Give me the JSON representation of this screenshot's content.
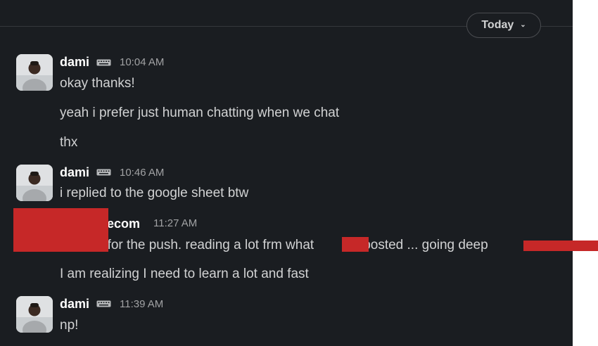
{
  "divider": {
    "label": "Today",
    "chevron_icon": "chevron-down-icon"
  },
  "messages": [
    {
      "author": "dami",
      "time": "10:04 AM",
      "lines": [
        "okay thanks!",
        "yeah i prefer just human chatting when we chat",
        "thx"
      ]
    },
    {
      "author": "dami",
      "time": "10:46 AM",
      "lines": [
        "i replied to the google sheet btw"
      ]
    },
    {
      "author": "ecom",
      "time": "11:27 AM",
      "lines": [
        "Thanks for the push. reading a lot frm what",
        "posted ... going deep",
        "I am realizing I need to learn a lot and fast"
      ]
    },
    {
      "author": "dami",
      "time": "11:39 AM",
      "lines": [
        "np!"
      ]
    }
  ],
  "colors": {
    "background": "#1a1d21",
    "text": "#d1d2d3",
    "muted": "#a1a2a4",
    "redaction": "#c62828"
  },
  "icons": {
    "status": "keyboard-icon"
  }
}
